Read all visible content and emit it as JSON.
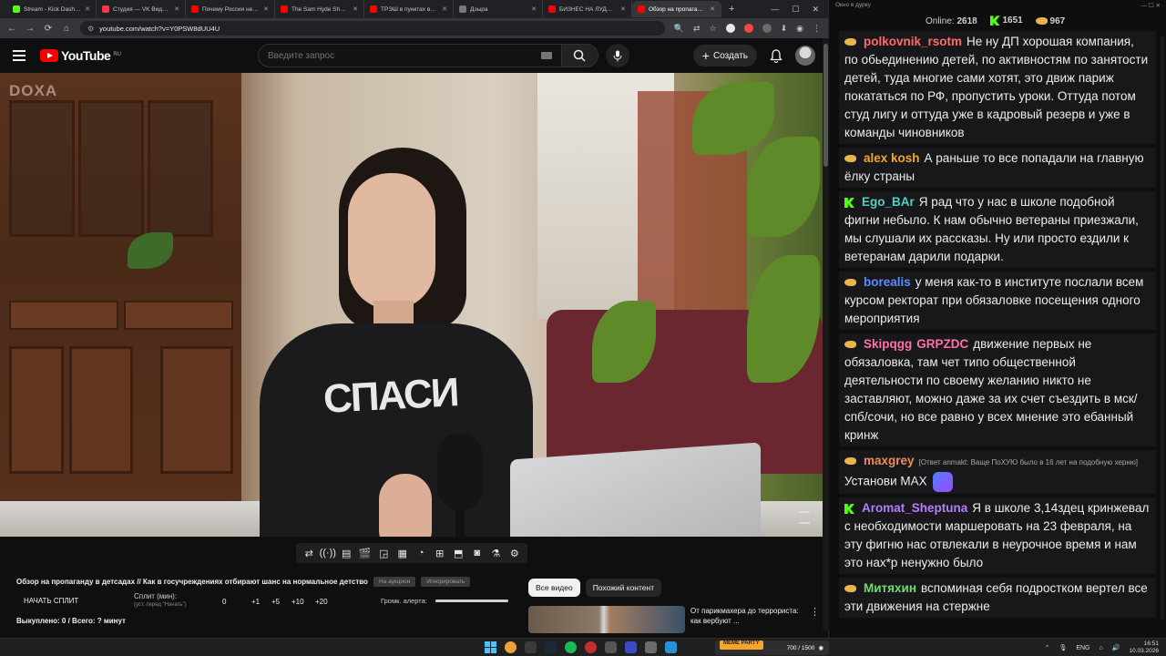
{
  "browser": {
    "tabs": [
      {
        "label": "Stream - Kick Dashboard",
        "color": "#53fc18",
        "active": false
      },
      {
        "label": "Студия — VK Видео Live",
        "color": "#ff3347",
        "active": false
      },
      {
        "label": "Почему России не даже...",
        "color": "#ff0000",
        "active": false
      },
      {
        "label": "The Sam Hyde Show: O...",
        "color": "#ff0000",
        "active": false
      },
      {
        "label": "ТРЭШ в пунктах выд...",
        "color": "#ff0000",
        "active": false
      },
      {
        "label": "Дзыра",
        "color": "#777777",
        "active": false
      },
      {
        "label": "БИЗНЕС НА ЛУДОМАН...",
        "color": "#ff0000",
        "active": false
      },
      {
        "label": "Обзор на пропаганд...",
        "color": "#ff0000",
        "active": true
      }
    ],
    "url": "youtube.com/watch?v=Y0PSW8dUU4U"
  },
  "masthead": {
    "logo": "YouTube",
    "country": "RU",
    "search_placeholder": "Введите запрос",
    "create_label": "Создать"
  },
  "video": {
    "watermark": "DOXA",
    "sweater_text": "СПАСИ"
  },
  "below": {
    "title": "Обзор на пропаганду в детсадах // Как в госучреждениях отбирают шанс на нормальное детство",
    "pill_auction": "На аукцион",
    "pill_ignore": "Игнорировать",
    "split_button": "НАЧАТЬ СПЛИТ",
    "split_label": "Сплит (мин):",
    "split_hint": "(уст. перед \"Начать\")",
    "split_values": [
      "0",
      "+1",
      "+5",
      "+10",
      "+20"
    ],
    "alert_label": "Громк. алерта:",
    "alert_volume": 1.0,
    "bought": "Выкуплено: 0 / Всего: ? минут",
    "chips": [
      "Все видео",
      "Похожий контент"
    ],
    "reco_title": "От парикмахера до террориста: как вербуют ..."
  },
  "chat": {
    "window_title": "Окно в дурку",
    "online_label": "Online:",
    "online_count": "2618",
    "kick_count": "1651",
    "coin_count": "967",
    "messages": [
      {
        "nick": "polkovnik_rsotm",
        "color": "#ff6b6b",
        "badge": "coin",
        "text": "Не ну ДП хорошая компания, по обьединению детей, по активностям по занятости детей, туда многие сами хотят, это движ париж покататься по РФ, пропустить уроки. Оттуда потом студ лигу и оттуда уже в кадровый резерв и уже в команды чиновников"
      },
      {
        "nick": "alex kosh",
        "color": "#f5a623",
        "badge": "coin",
        "text": "А раньше то все попадали на главную ёлку страны"
      },
      {
        "nick": "Ego_BAr",
        "color": "#4fd1c5",
        "badge": "kick",
        "text": "Я рад что у нас в школе подобной фигни небыло. К нам обычно ветераны приезжали, мы слушали их рассказы. Ну или просто ездили к ветеранам дарили подарки."
      },
      {
        "nick": "borealis",
        "color": "#5b8cff",
        "badge": "coin",
        "text": "у меня как-то в институте послали всем курсом ректорат при обязаловке посещения одного мероприятия"
      },
      {
        "nick": "Skipqgg",
        "nick2": "GRPZDC",
        "color": "#ff6fa8",
        "badge": "coin",
        "text": "движение первых не обязаловка, там чет типо общественной деятельности по своему желанию никто не заставляют, можно даже за их счет съездить в мск/спб/сочи, но все равно у всех мнение это ебанный кринж"
      },
      {
        "nick": "maxgrey",
        "color": "#f08c5a",
        "badge": "coin",
        "reply": "[Ответ anmakt: Ваще ПоХУЮ было в 16 лет на подобную херню]",
        "text": "Установи MAX"
      },
      {
        "nick": "Aromat_Sheptuna",
        "color": "#b77dff",
        "badge": "kick",
        "text": "Я в школе 3,14здец кринжевал с необходимости маршеровать на 23 февраля, на эту фигню нас отвлекали в неурочное время и нам это нах*р ненужно было"
      },
      {
        "nick": "Митяхин",
        "color": "#6fdc6f",
        "badge": "coin",
        "text": "вспоминая себя подростком вертел все эти движения на стержне"
      }
    ]
  },
  "taskbar": {
    "app_label": "700 / 1500",
    "badge_label": "MEME PARTY",
    "lang": "ENG",
    "time": "16:51",
    "date": "10.03.2026"
  }
}
